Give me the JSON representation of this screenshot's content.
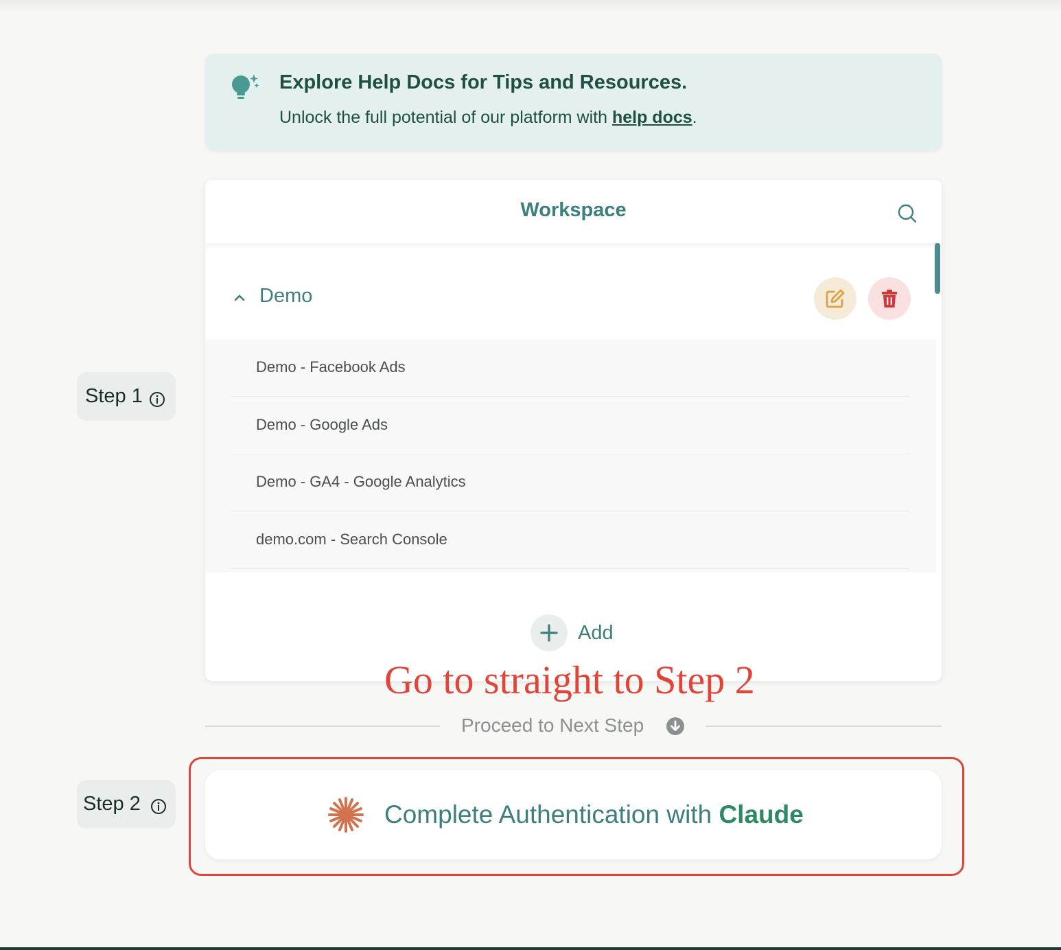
{
  "tip": {
    "title": "Explore Help Docs for Tips and Resources.",
    "text_prefix": "Unlock the full potential of our platform with ",
    "link": "help docs",
    "text_suffix": "."
  },
  "steps": {
    "step1": "Step 1",
    "step2": "Step 2"
  },
  "workspace": {
    "title": "Workspace",
    "group": {
      "name": "Demo",
      "expanded": true,
      "items": [
        "Demo - Facebook Ads",
        "Demo - Google Ads",
        "Demo - GA4 - Google Analytics",
        "demo.com - Search Console"
      ]
    },
    "add_label": "Add"
  },
  "annotation": "Go to straight to Step 2",
  "proceed": "Proceed to Next Step",
  "auth": {
    "prefix": "Complete Authentication with ",
    "brand": "Claude"
  },
  "icons": {
    "tip": "lightbulb-sparkle-icon",
    "info": "info-icon",
    "search": "search-icon",
    "collapse": "chevron-up-icon",
    "edit": "edit-icon",
    "delete": "trash-icon",
    "add": "plus-icon",
    "proceed": "arrow-down-circle-icon",
    "claude": "claude-logo-icon"
  },
  "colors": {
    "primary_teal": "#3d7f7c",
    "tip_bg": "#e3f0ee",
    "edit_accent": "#d9a441",
    "delete_accent": "#d0393b",
    "annotation_red": "#e0453a",
    "claude_brand": "#d0734e",
    "brand_green": "#2f8a63"
  }
}
